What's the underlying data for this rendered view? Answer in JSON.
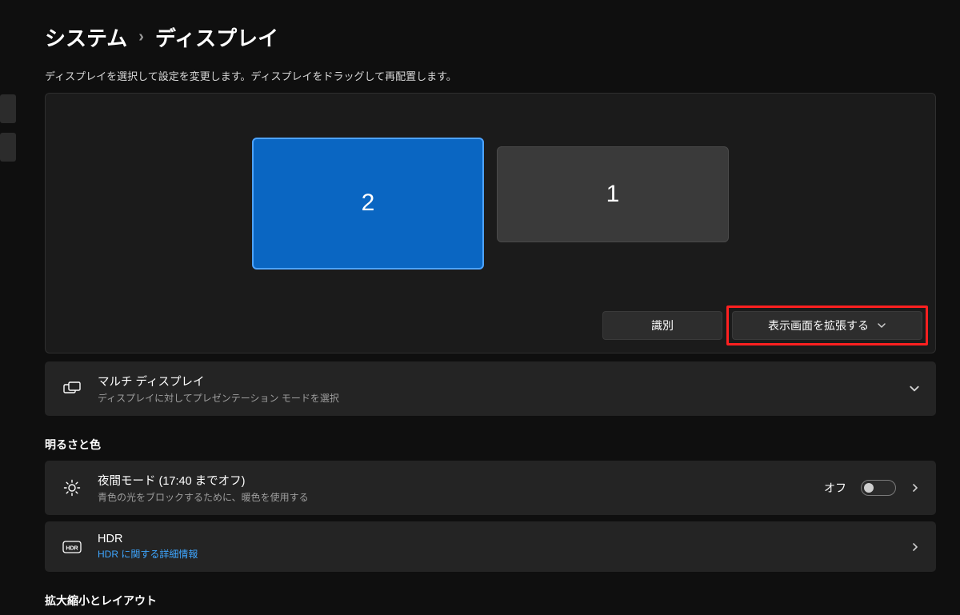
{
  "breadcrumb": {
    "parent": "システム",
    "current": "ディスプレイ"
  },
  "subtitle": "ディスプレイを選択して設定を変更します。ディスプレイをドラッグして再配置します。",
  "monitors": {
    "selected_label": "2",
    "other_label": "1"
  },
  "arrange_actions": {
    "identify": "識別",
    "extend": "表示画面を拡張する"
  },
  "multi_display": {
    "title": "マルチ ディスプレイ",
    "sub": "ディスプレイに対してプレゼンテーション モードを選択"
  },
  "section_brightness": "明るさと色",
  "night_light": {
    "title": "夜間モード (17:40 までオフ)",
    "sub": "青色の光をブロックするために、暖色を使用する",
    "state": "オフ"
  },
  "hdr": {
    "title": "HDR",
    "sub": "HDR に関する詳細情報"
  },
  "section_scale": "拡大縮小とレイアウト"
}
